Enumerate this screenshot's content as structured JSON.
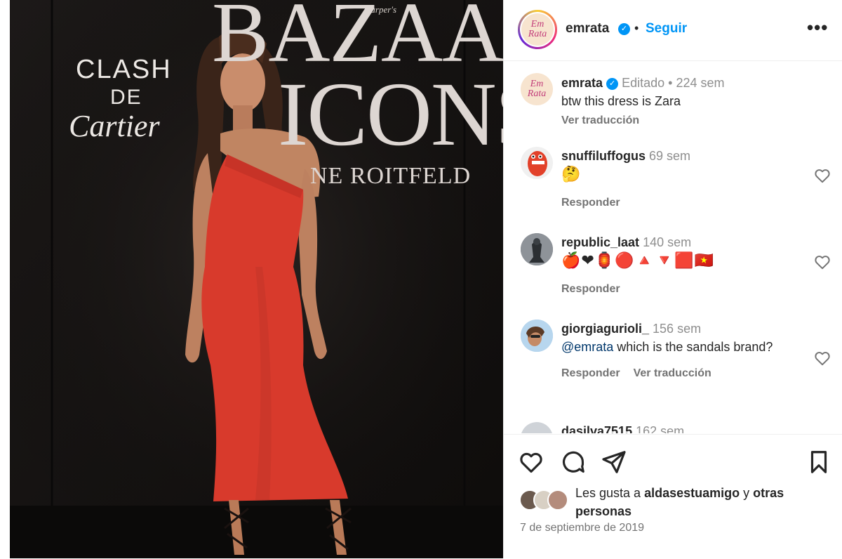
{
  "photo": {
    "backdrop_brand_1": "CLASH",
    "backdrop_brand_2": "DE",
    "backdrop_brand_3": "Cartier",
    "backdrop_magazine_small": "Harper's",
    "backdrop_magazine": "BAZAAR",
    "backdrop_magazine_2": "ICONS",
    "backdrop_magazine_3": "NE ROITFELD"
  },
  "header": {
    "avatar_text": [
      "Em",
      "Rata"
    ],
    "username": "emrata",
    "separator": "•",
    "follow_label": "Seguir",
    "more_label": "•••"
  },
  "caption": {
    "username": "emrata",
    "edited": "Editado",
    "separator": "•",
    "time": "224 sem",
    "text": "btw this dress is Zara",
    "translate": "Ver traducción"
  },
  "comments": [
    {
      "username": "snuffiluffogus",
      "time": "69 sem",
      "text": "🤔",
      "reply": "Responder"
    },
    {
      "username": "republic_laat",
      "time": "140 sem",
      "text": "🍎❤🏮🔴🔺🔻🟥🇻🇳",
      "reply": "Responder"
    },
    {
      "username": "giorgiagurioli_",
      "time": "156 sem",
      "mention": "@emrata",
      "text": " which is the sandals brand?",
      "reply": "Responder",
      "translate": "Ver traducción"
    },
    {
      "username": "dasilva7515",
      "time": "162 sem"
    }
  ],
  "likes": {
    "prefix": "Les gusta a ",
    "user": "aldasestuamigo",
    "suffix_1": " y ",
    "suffix_2": "otras personas"
  },
  "date": "7 de septiembre de 2019",
  "colors": {
    "accent": "#0095f6",
    "dress": "#d83a2c",
    "backdrop": "#141211"
  }
}
